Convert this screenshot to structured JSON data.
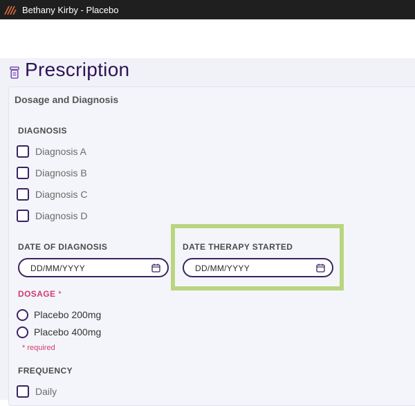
{
  "window": {
    "title": "Bethany Kirby - Placebo",
    "logo_icon": "app-logo-icon"
  },
  "page": {
    "title": "Prescription",
    "title_icon": "prescription-bottle-icon"
  },
  "card": {
    "header": "Dosage and Diagnosis"
  },
  "diagnosis": {
    "label": "DIAGNOSIS",
    "options": [
      "Diagnosis A",
      "Diagnosis B",
      "Diagnosis C",
      "Diagnosis D"
    ]
  },
  "date_of_diagnosis": {
    "label": "DATE OF DIAGNOSIS",
    "placeholder": "DD/MM/YYYY",
    "value": ""
  },
  "date_therapy_started": {
    "label": "DATE THERAPY STARTED",
    "placeholder": "DD/MM/YYYY",
    "value": ""
  },
  "dosage": {
    "label": "DOSAGE",
    "required_marker": "*",
    "options": [
      "Placebo 200mg",
      "Placebo 400mg"
    ],
    "required_note": "* required"
  },
  "frequency": {
    "label": "FREQUENCY",
    "options": [
      "Daily"
    ]
  },
  "colors": {
    "accent": "#3a2262",
    "title": "#2e1457",
    "required": "#d23b6c",
    "highlight": "#b9d57f",
    "titlebar": "#1f1f1f"
  }
}
